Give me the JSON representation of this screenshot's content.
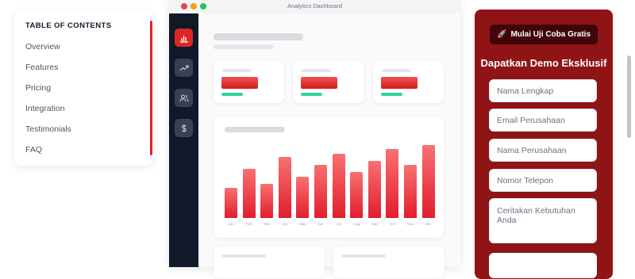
{
  "toc": {
    "title": "TABLE OF CONTENTS",
    "items": [
      "Overview",
      "Features",
      "Pricing",
      "Integration",
      "Testimonials",
      "FAQ"
    ]
  },
  "dashboard": {
    "window_title": "Analytics Dashboard",
    "sidebar_icons": [
      "bar-chart-icon",
      "trending-up-icon",
      "users-icon",
      "dollar-icon"
    ],
    "chart_data": {
      "type": "bar",
      "categories": [
        "Jan",
        "Feb",
        "Mar",
        "Apr",
        "May",
        "Jun",
        "Jul",
        "Aug",
        "Sep",
        "Oct",
        "Nov",
        "Dec"
      ],
      "values": [
        38,
        62,
        43,
        77,
        52,
        67,
        81,
        58,
        72,
        87,
        67,
        92
      ],
      "ylim": [
        0,
        100
      ]
    }
  },
  "form": {
    "trial_icon": "rocket-icon",
    "trial_label": "Mulai Uji Coba Gratis",
    "title": "Dapatkan Demo Eksklusif",
    "name_placeholder": "Nama Lengkap",
    "email_placeholder": "Email Perusahaan",
    "company_placeholder": "Nama Perusahaan",
    "phone_placeholder": "Nomor Telepon",
    "needs_placeholder": "Ceritakan Kebutuhan Anda"
  },
  "colors": {
    "accent": "#dc2626",
    "panel": "#8f1416",
    "sidebar": "#111827",
    "success": "#34d399"
  }
}
